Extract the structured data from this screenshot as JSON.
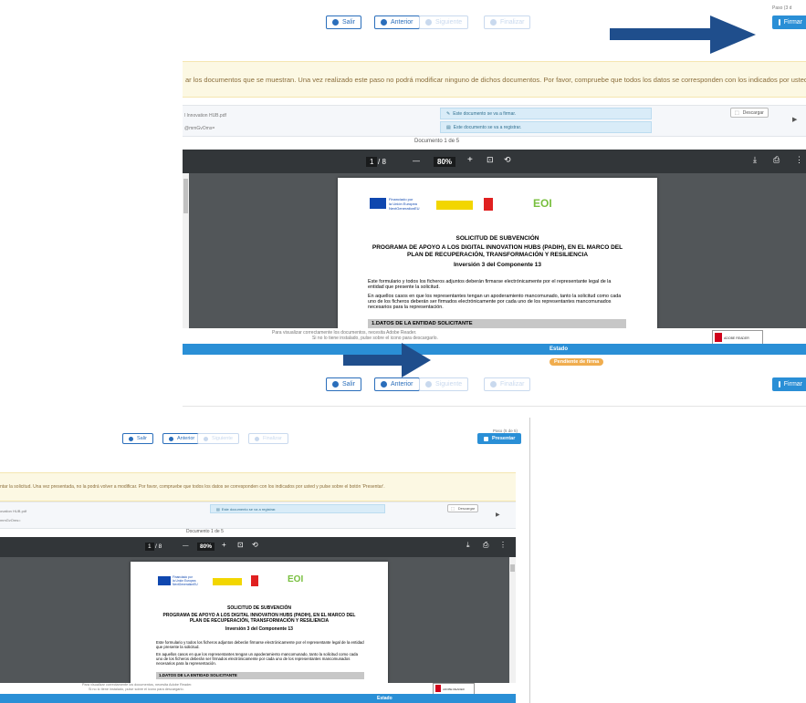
{
  "top": {
    "paso_label": "Paso (3 d",
    "buttons": {
      "salir": "Salir",
      "anterior": "Anterior",
      "siguiente": "Siguiente",
      "finalizar": "Finalizar",
      "firmar": "Firmar"
    },
    "warning": "ar los documentos que se muestran. Una vez realizado este paso no podrá modificar ninguno de dichos documentos. Por favor, compruebe que todos los datos se corresponden con los indicados por usted y",
    "doc_filename": "l Innovation HUB.pdf",
    "doc_sub": "@mmGvOms=",
    "doc_line_firmar": "Este documento se va a firmar.",
    "doc_line_registrar": "Este documento se va a registrar.",
    "descargar": "Descargar",
    "doc_counter": "Documento 1 de 5",
    "pdf": {
      "page": "1",
      "total": "/ 8",
      "zoom": "80%"
    },
    "reader_note1": "Para visualizar correctamente los documentos, necesita Adobe Reader.",
    "reader_note2": "Si no lo tiene instalado, pulse sobre el icono para descargarlo.",
    "adobe_label": "ADOBE READER",
    "estado": "Estado",
    "estado_badge": "Pendiente de firma",
    "footer": "a ... ... ... ... ... ... ... ... ... ... ... ... ... ... ..."
  },
  "bottom": {
    "paso_label": "Paso (5 de 5)",
    "buttons": {
      "salir": "Salir",
      "anterior": "Anterior",
      "siguiente": "Siguiente",
      "finalizar": "Finalizar",
      "presentar": "Presentar"
    },
    "warning": "ntar la solicitud. Una vez presentada, no la podrá volver a modificar. Por favor, compruebe que todos los datos se corresponden con los indicados por usted y pulse sobre el botón 'Presentar'.",
    "doc_filename": "ovation HUB.pdf",
    "doc_sub": "mmGvOms=",
    "doc_line_registrar": "Este documento se va a registrar.",
    "descargar": "Descargar",
    "doc_counter": "Documento 1 de 5",
    "pdf": {
      "page": "1",
      "total": "/ 8",
      "zoom": "80%"
    },
    "reader_note1": "Para visualizar correctamente los documentos, necesita Adobe Reader.",
    "reader_note2": "Si no lo tiene instalado, pulse sobre el icono para descargarlo.",
    "adobe_label": "ADOBE READER",
    "estado": "Estado"
  },
  "pdf_doc": {
    "eu_l1": "Financiado por",
    "eu_l2": "la Unión Europea",
    "eu_l3": "NextGenerationEU",
    "title1": "SOLICITUD DE SUBVENCIÓN",
    "title2": "PROGRAMA DE APOYO A LOS DIGITAL INNOVATION HUBS (PADIH), EN EL MARCO DEL",
    "title3": "PLAN DE RECUPERACIÓN, TRANSFORMACIÓN Y RESILIENCIA",
    "title4": "Inversión 3 del Componente 13",
    "p1": "Este formulario y todos los ficheros adjuntos deberán firmarse electrónicamente por el representante legal de la entidad que presente la solicitud.",
    "p2": "En aquellos casos en que los representantes tengan un apoderamiento mancomunado, tanto la solicitud como cada uno de los ficheros deberán ser firmados electrónicamente por cada uno de los representantes mancomunados necesarios para la representación.",
    "section": "1.DATOS DE LA ENTIDAD SOLICITANTE",
    "eoi": "EOI"
  },
  "colors": {
    "arrow": "#1f4e8c",
    "primary": "#2a8fd6",
    "toolbar": "#323639",
    "viewer_bg": "#525659"
  }
}
